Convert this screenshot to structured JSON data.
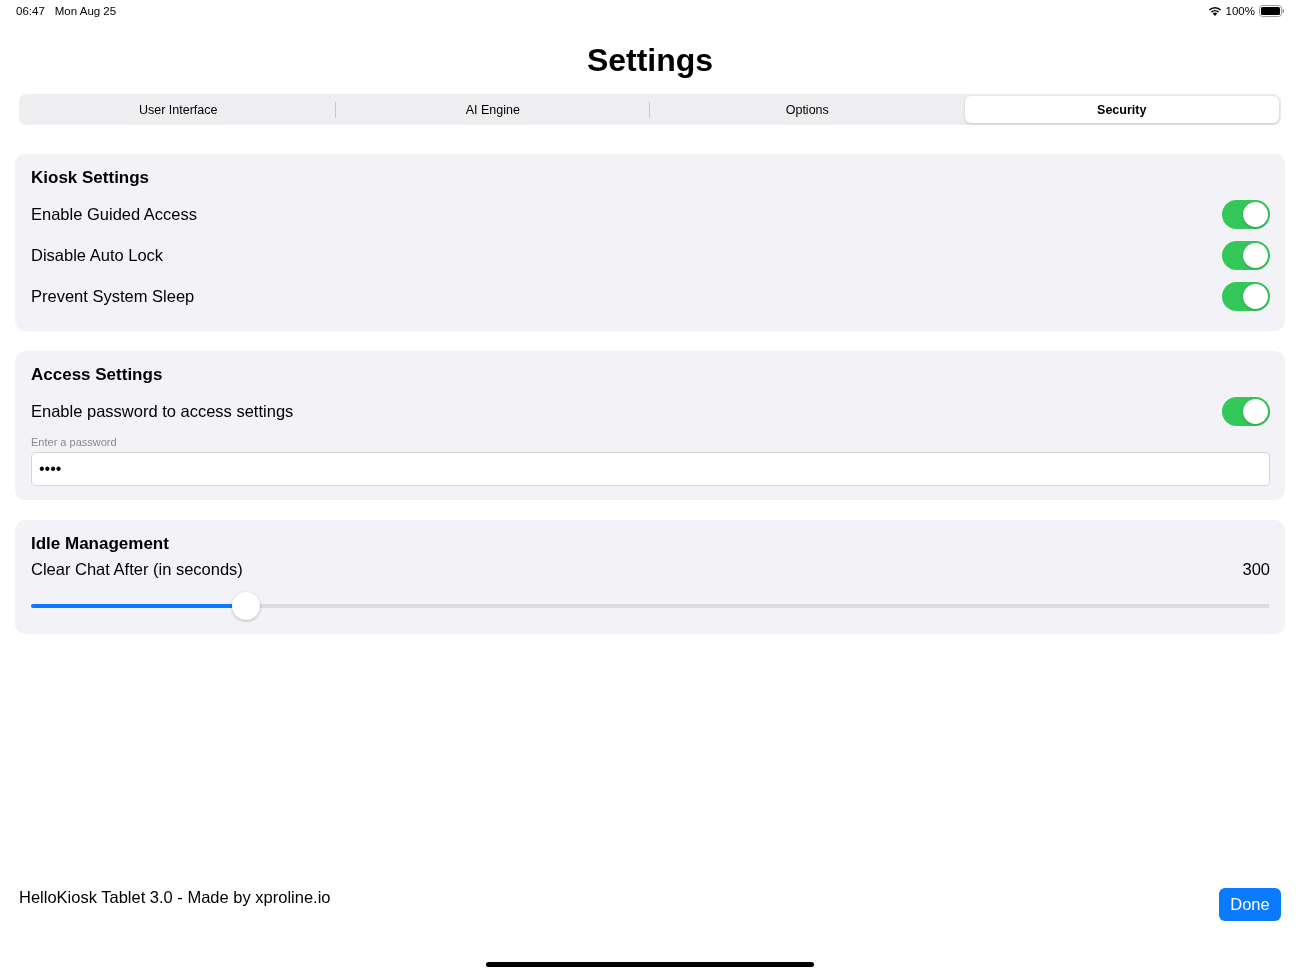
{
  "status_bar": {
    "time": "06:47",
    "date": "Mon Aug 25",
    "battery": "100%"
  },
  "title": "Settings",
  "tabs": [
    {
      "label": "User Interface",
      "selected": false
    },
    {
      "label": "AI Engine",
      "selected": false
    },
    {
      "label": "Options",
      "selected": false
    },
    {
      "label": "Security",
      "selected": true
    }
  ],
  "sections": [
    {
      "title": "Kiosk Settings",
      "items": [
        {
          "kind": "toggle",
          "label": "Enable Guided Access",
          "on": true
        },
        {
          "kind": "toggle",
          "label": "Disable Auto Lock",
          "on": true
        },
        {
          "kind": "toggle",
          "label": "Prevent System Sleep",
          "on": true
        }
      ]
    },
    {
      "title": "Access Settings",
      "items": [
        {
          "kind": "toggle",
          "label": "Enable password to access settings",
          "on": true
        },
        {
          "kind": "field",
          "label": "Enter a password",
          "value": "••••"
        }
      ]
    },
    {
      "title": "Idle Management",
      "items": [
        {
          "kind": "slider",
          "label": "Clear Chat After (in seconds)",
          "reading": "300",
          "level": 0.174
        }
      ]
    }
  ],
  "footer": {
    "text": "HelloKiosk Tablet 3.0 - Made by xproline.io",
    "button": "Done"
  }
}
